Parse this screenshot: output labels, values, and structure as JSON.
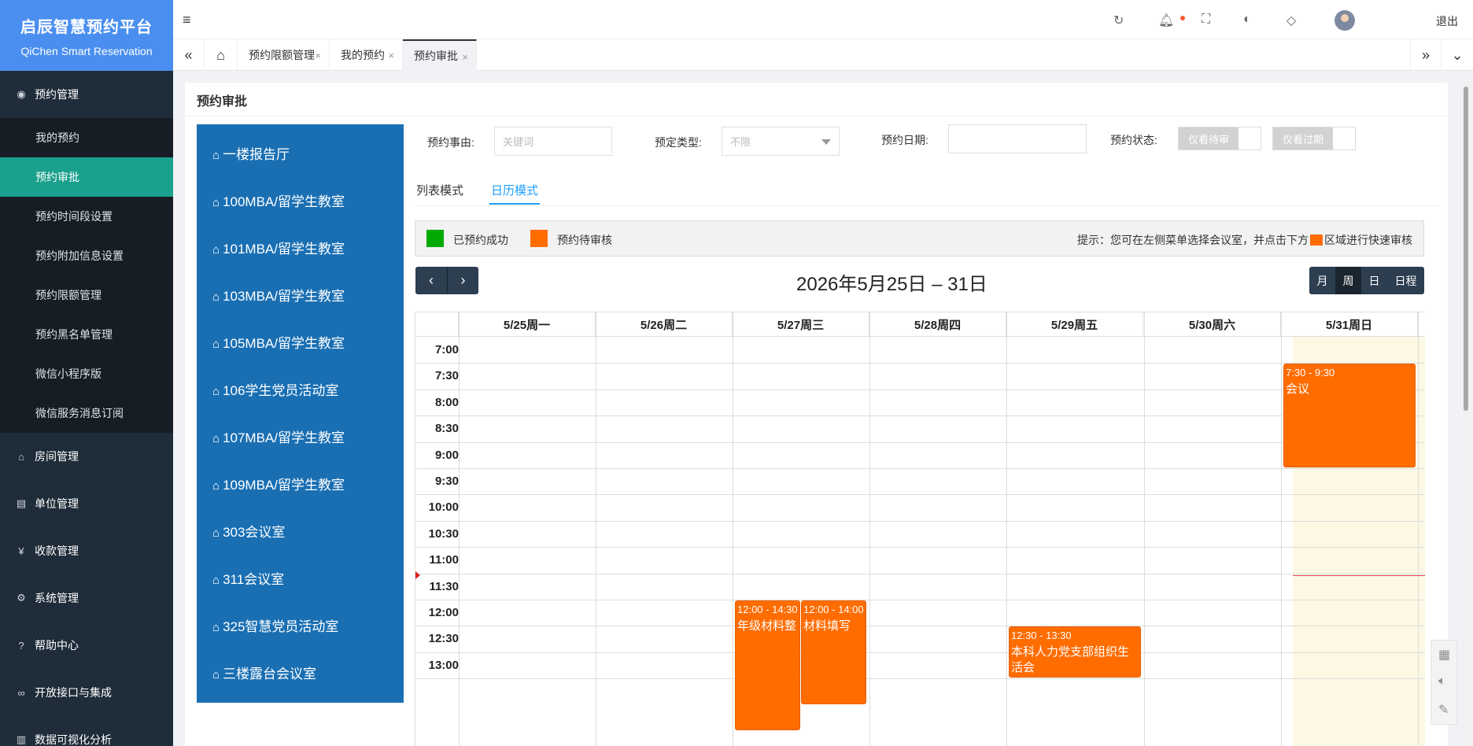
{
  "app": {
    "title": "启辰智慧预约平台",
    "subtitle": "QiChen Smart Reservation"
  },
  "sidebar": {
    "group_reservation": "预约管理",
    "items": [
      "我的预约",
      "预约审批",
      "预约时间段设置",
      "预约附加信息设置",
      "预约限额管理",
      "预约黑名单管理",
      "微信小程序版",
      "微信服务消息订阅"
    ],
    "active_item": "预约审批",
    "groups": [
      "房间管理",
      "单位管理",
      "收款管理",
      "系统管理",
      "帮助中心",
      "开放接口与集成",
      "数据可视化分析"
    ]
  },
  "topbar": {
    "fold_icon": "≡",
    "logout": "退出"
  },
  "tabs": {
    "items": [
      "预约限额管理",
      "我的预约",
      "预约审批"
    ],
    "active": "预约审批"
  },
  "page": {
    "title": "预约审批"
  },
  "rooms": [
    "一楼报告厅",
    "100MBA/留学生教室",
    "101MBA/留学生教室",
    "103MBA/留学生教室",
    "105MBA/留学生教室",
    "106学生党员活动室",
    "107MBA/留学生教室",
    "109MBA/留学生教室",
    "303会议室",
    "311会议室",
    "325智慧党员活动室",
    "三楼露台会议室"
  ],
  "filters": {
    "reason_label": "预约事由:",
    "reason_placeholder": "关键词",
    "type_label": "预定类型:",
    "type_value": "不限",
    "date_label": "预约日期:",
    "date_value": "",
    "status_label": "预约状态:",
    "only_pending": "仅看待审",
    "only_expired": "仅看过期"
  },
  "modes": {
    "list": "列表模式",
    "calendar": "日历模式",
    "active": "日历模式"
  },
  "legend": {
    "success_label": "已预约成功",
    "success_color": "#00aa00",
    "pending_label": "预约待审核",
    "pending_color": "#ff6c00",
    "hint_prefix": "提示：您可在左侧菜单选择会议室，并点击下方",
    "hint_suffix": "区域进行快速审核"
  },
  "calendar": {
    "title": "2026年5月25日 – 31日",
    "prev": "‹",
    "next": "›",
    "views": [
      "月",
      "周",
      "日",
      "日程"
    ],
    "active_view": "周",
    "days": [
      "5/25周一",
      "5/26周二",
      "5/27周三",
      "5/28周四",
      "5/29周五",
      "5/30周六",
      "5/31周日"
    ],
    "today_day": "5/31周日",
    "times": [
      "7:00",
      "7:30",
      "8:00",
      "8:30",
      "9:00",
      "9:30",
      "10:00",
      "10:30",
      "11:00",
      "11:30",
      "12:00",
      "12:30",
      "13:00"
    ],
    "events": [
      {
        "day": "5/31周日",
        "start": "7:30",
        "end": "9:30",
        "time": "7:30 - 9:30",
        "title": "会议",
        "status": "pending"
      },
      {
        "day": "5/27周三",
        "start": "12:00",
        "end": "14:30",
        "time": "12:00 - 14:30",
        "title": "年级材料整",
        "status": "pending"
      },
      {
        "day": "5/27周三",
        "start": "12:00",
        "end": "14:00",
        "time": "12:00 - 14:00",
        "title": "材料填写",
        "status": "pending"
      },
      {
        "day": "5/29周五",
        "start": "12:30",
        "end": "13:30",
        "time": "12:30 - 13:30",
        "title": "本科人力党支部组织生活会",
        "status": "pending"
      }
    ]
  }
}
